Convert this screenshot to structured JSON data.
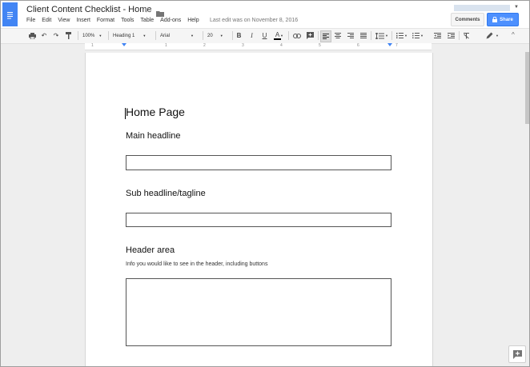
{
  "app": {
    "title": "Client Content Checklist - Home",
    "last_edit": "Last edit was on November 8, 2016"
  },
  "menu": [
    "File",
    "Edit",
    "View",
    "Insert",
    "Format",
    "Tools",
    "Table",
    "Add-ons",
    "Help"
  ],
  "buttons": {
    "comments": "Comments",
    "share": "Share"
  },
  "toolbar": {
    "zoom": "100%",
    "style": "Heading 1",
    "font": "Arial",
    "size": "20"
  },
  "ruler": [
    "1",
    "1",
    "2",
    "3",
    "4",
    "5",
    "6",
    "7"
  ],
  "document": {
    "title": "Home Page",
    "sections": [
      {
        "heading": "Main headline"
      },
      {
        "heading": "Sub headline/tagline"
      },
      {
        "heading": "Header area",
        "note": "Info you would like to see in the header, including buttons"
      }
    ]
  },
  "colors": {
    "brand": "#4285f4",
    "share_button": "#4d90fe"
  }
}
